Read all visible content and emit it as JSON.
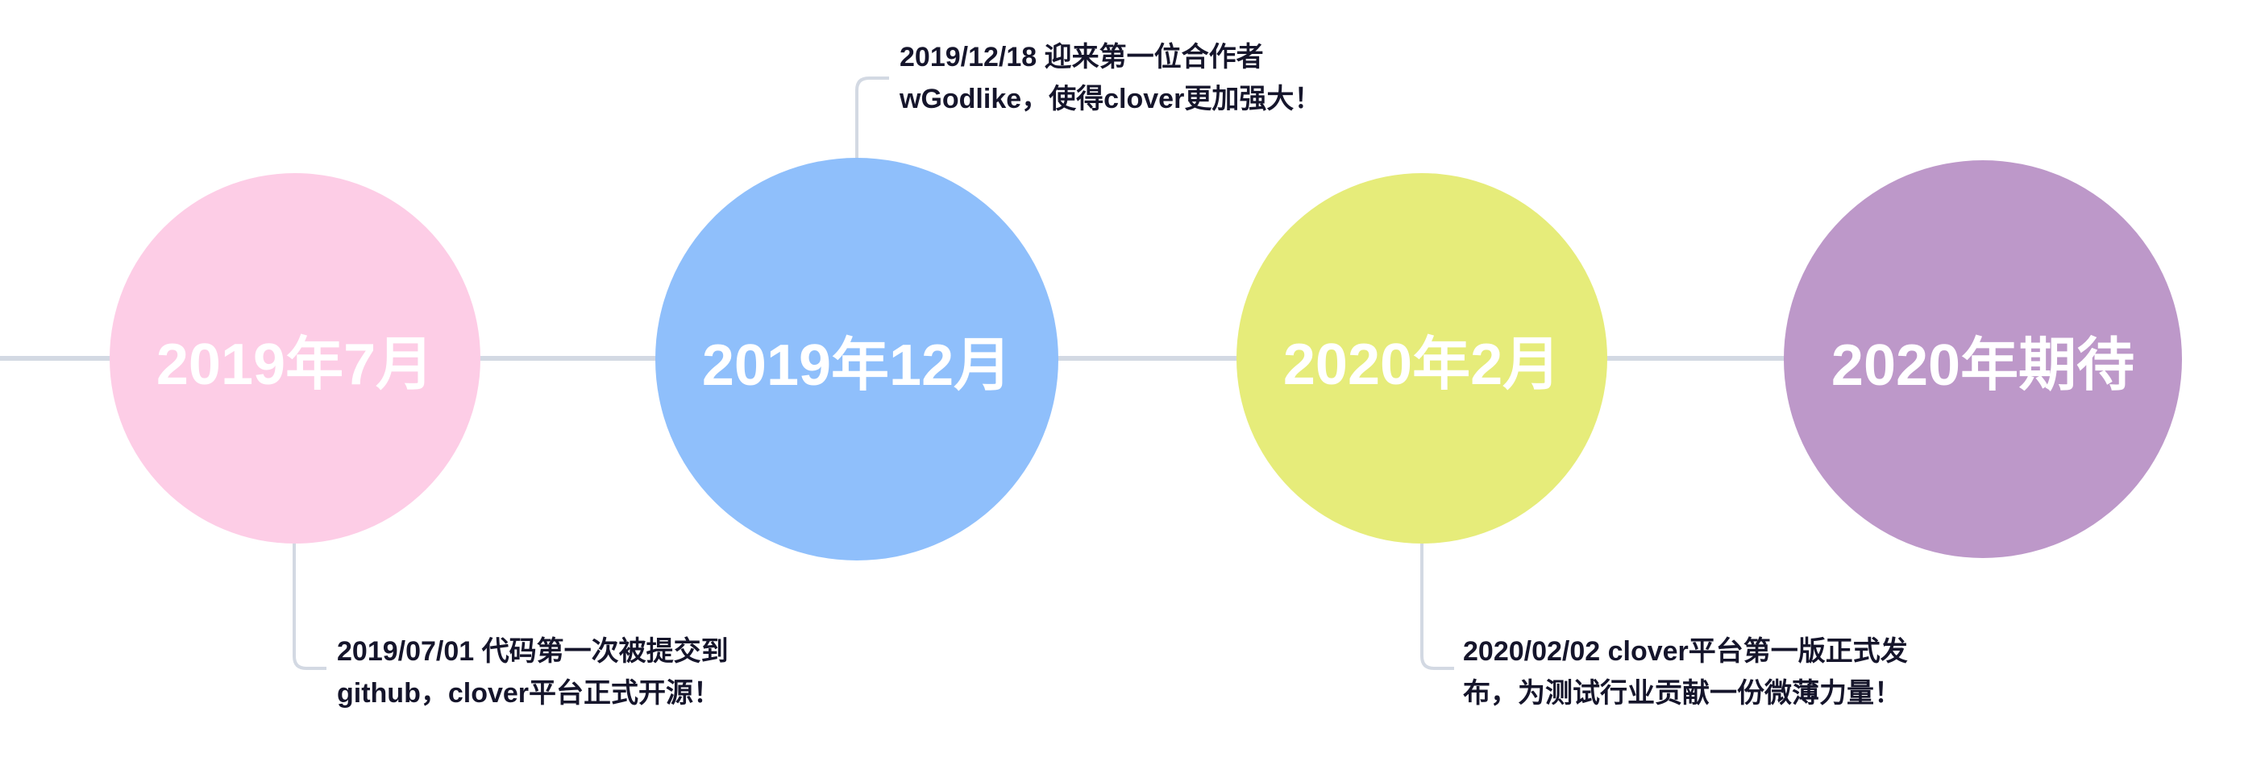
{
  "colors": {
    "line": "#d3d9e3",
    "node1": "#fdcde6",
    "node2": "#8fbffb",
    "node3": "#e6ec7a",
    "node4": "#bd98c9",
    "note_text": "#15152b"
  },
  "milestones": [
    {
      "label": "2019年7月",
      "note": [
        "2019/07/01 代码第一次被提交到",
        "github，clover平台正式开源！"
      ]
    },
    {
      "label": "2019年12月",
      "note": [
        "2019/12/18 迎来第一位合作者",
        "wGodlike，使得clover更加强大！"
      ]
    },
    {
      "label": "2020年2月",
      "note": [
        "2020/02/02 clover平台第一版正式发",
        "布，为测试行业贡献一份微薄力量！"
      ]
    },
    {
      "label": "2020年期待",
      "note": []
    }
  ]
}
